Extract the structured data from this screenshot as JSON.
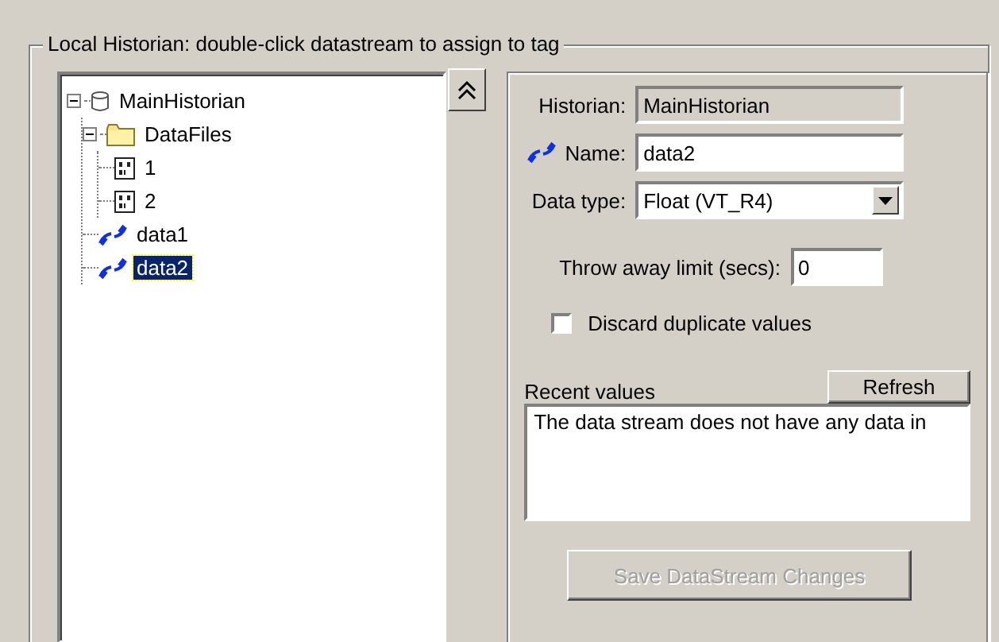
{
  "group": {
    "title": "Local Historian: double-click datastream to assign to tag"
  },
  "tree": [
    {
      "label": "MainHistorian",
      "kind": "historian",
      "expanded": true,
      "selected": false,
      "children": [
        {
          "label": "DataFiles",
          "kind": "folder",
          "expanded": true,
          "selected": false,
          "children": [
            {
              "label": "1",
              "kind": "file",
              "selected": false
            },
            {
              "label": "2",
              "kind": "file",
              "selected": false
            }
          ]
        },
        {
          "label": "data1",
          "kind": "stream",
          "selected": false
        },
        {
          "label": "data2",
          "kind": "stream",
          "selected": true
        }
      ]
    }
  ],
  "details": {
    "historian": {
      "label": "Historian:",
      "value": "MainHistorian"
    },
    "name": {
      "label": "Name:",
      "value": "data2"
    },
    "data_type": {
      "label": "Data type:",
      "value": "Float (VT_R4)"
    },
    "throw_away": {
      "label": "Throw away limit (secs):",
      "value": "0"
    },
    "discard": {
      "label": "Discard duplicate values",
      "checked": false
    },
    "recent": {
      "label": "Recent values",
      "refresh": "Refresh",
      "text": "The data stream does not have any data in"
    },
    "save": {
      "label": "Save DataStream Changes",
      "disabled": true
    }
  }
}
